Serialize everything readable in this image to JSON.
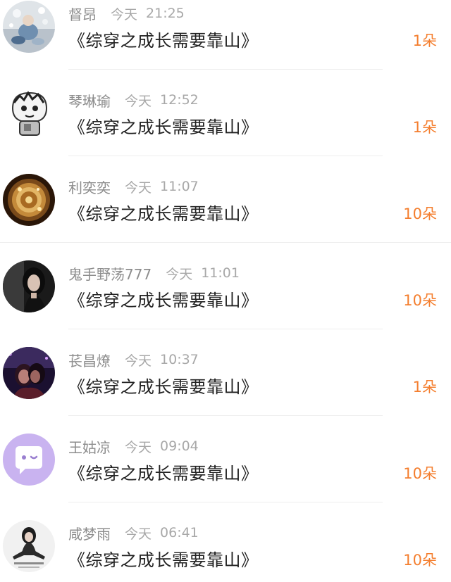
{
  "comments": [
    {
      "name": "督昂",
      "day": "今天",
      "time": "21:25",
      "text": "《综穿之成长需要靠山》",
      "gift": "1朵",
      "avatar": "snowy-figure-avatar"
    },
    {
      "name": "琴琳瑜",
      "day": "今天",
      "time": "12:52",
      "text": "《综穿之成长需要靠山》",
      "gift": "1朵",
      "avatar": "cartoon-sketch-avatar"
    },
    {
      "name": "利奕奕",
      "day": "今天",
      "time": "11:07",
      "text": "《综穿之成长需要靠山》",
      "gift": "10朵",
      "avatar": "pocket-watch-avatar"
    },
    {
      "name": "鬼手野荡777",
      "day": "今天",
      "time": "11:01",
      "text": "《综穿之成长需要靠山》",
      "gift": "10朵",
      "avatar": "girl-photo-avatar"
    },
    {
      "name": "苌昌燎",
      "day": "今天",
      "time": "10:37",
      "text": "《综穿之成长需要靠山》",
      "gift": "1朵",
      "avatar": "couple-photo-avatar"
    },
    {
      "name": "王姑凉",
      "day": "今天",
      "time": "09:04",
      "text": "《综穿之成长需要靠山》",
      "gift": "10朵",
      "avatar": "chat-bubble-avatar"
    },
    {
      "name": "咸梦雨",
      "day": "今天",
      "time": "06:41",
      "text": "《综穿之成长需要靠山》",
      "gift": "10朵",
      "avatar": "girl-sitting-avatar"
    }
  ],
  "colors": {
    "gift_orange": "#f47e2e",
    "name_gray": "#8d8d8d",
    "purple_avatar": "#c9b3f0"
  }
}
